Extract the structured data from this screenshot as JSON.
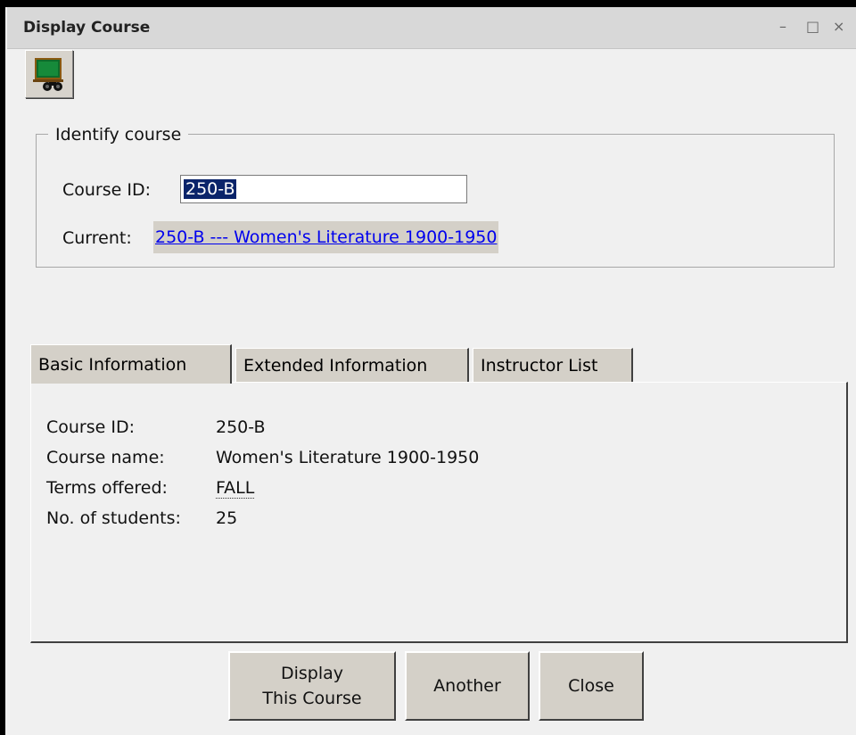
{
  "window": {
    "title": "Display Course",
    "controls": [
      "–",
      "□",
      "×"
    ]
  },
  "toolbar": {
    "icon": "display-course-icon"
  },
  "identify": {
    "legend": "Identify course",
    "course_id_label": "Course ID:",
    "course_id_value": "250-B",
    "current_label": "Current:",
    "current_link": "250-B --- Women's Literature 1900-1950"
  },
  "tabs": [
    {
      "label": "Basic Information",
      "active": true
    },
    {
      "label": "Extended Information",
      "active": false
    },
    {
      "label": "Instructor List",
      "active": false
    }
  ],
  "basic_info": {
    "course_id_label": "Course ID:",
    "course_id": "250-B",
    "course_name_label": "Course name:",
    "course_name": "Women's Literature 1900-1950",
    "terms_label": "Terms offered:",
    "terms": "FALL",
    "students_label": "No. of students:",
    "students": "25"
  },
  "buttons": {
    "display_line1": "Display",
    "display_line2": "This Course",
    "another": "Another",
    "close": "Close"
  }
}
